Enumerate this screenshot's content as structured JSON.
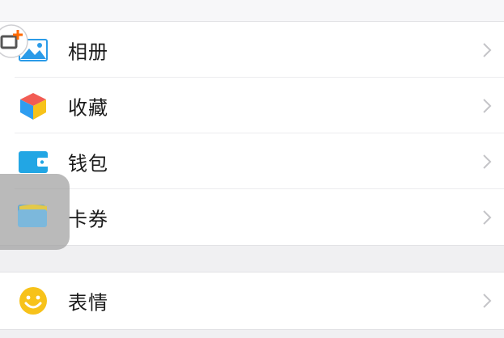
{
  "menu_group_1": [
    {
      "label": "相册",
      "icon": "album-icon"
    },
    {
      "label": "收藏",
      "icon": "favorites-cube-icon"
    },
    {
      "label": "钱包",
      "icon": "wallet-icon"
    },
    {
      "label": "卡券",
      "icon": "card-coupon-icon"
    }
  ],
  "menu_group_2": [
    {
      "label": "表情",
      "icon": "smiley-icon"
    }
  ],
  "colors": {
    "album": "#2b9be8",
    "wallet": "#22a6e4",
    "smiley": "#f7c21a",
    "floating_add": "#ff6a00"
  }
}
